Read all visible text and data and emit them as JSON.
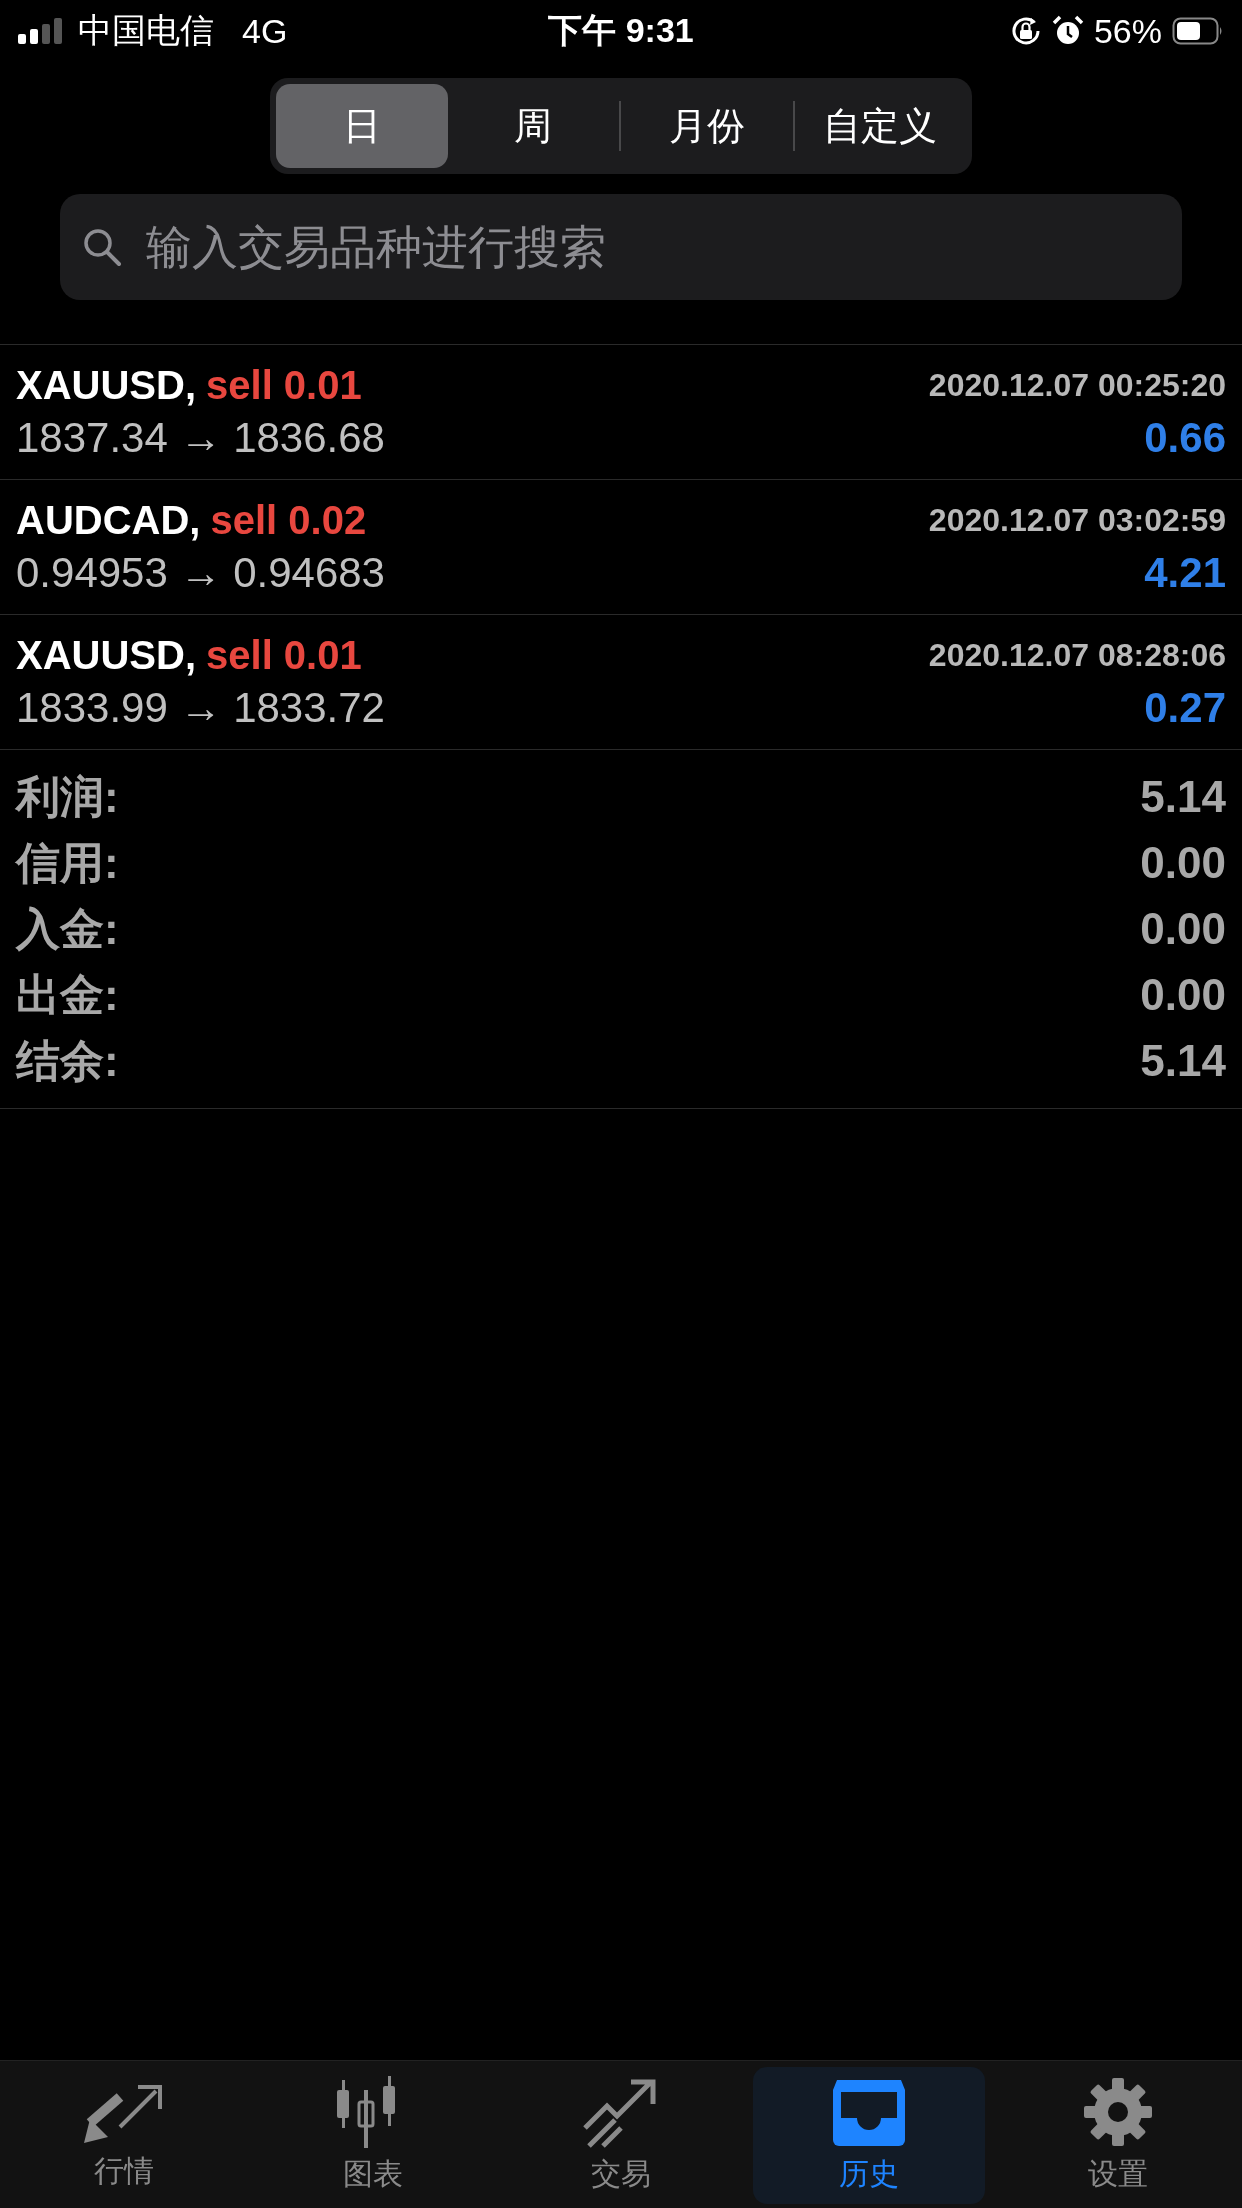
{
  "status_bar": {
    "carrier": "中国电信",
    "network": "4G",
    "time": "下午 9:31",
    "battery": "56%"
  },
  "period_tabs": [
    {
      "label": "日",
      "selected": true
    },
    {
      "label": "周",
      "selected": false
    },
    {
      "label": "月份",
      "selected": false
    },
    {
      "label": "自定义",
      "selected": false
    }
  ],
  "search": {
    "placeholder": "输入交易品种进行搜索"
  },
  "deals": [
    {
      "symbol": "XAUUSD,",
      "order": "sell 0.01",
      "time": "2020.12.07 00:25:20",
      "prices": "1837.34 → 1836.68",
      "profit": "0.66"
    },
    {
      "symbol": "AUDCAD,",
      "order": "sell 0.02",
      "time": "2020.12.07 03:02:59",
      "prices": "0.94953 → 0.94683",
      "profit": "4.21"
    },
    {
      "symbol": "XAUUSD,",
      "order": "sell 0.01",
      "time": "2020.12.07 08:28:06",
      "prices": "1833.99 → 1833.72",
      "profit": "0.27"
    }
  ],
  "summary": [
    {
      "label": "利润:",
      "value": "5.14"
    },
    {
      "label": "信用:",
      "value": "0.00"
    },
    {
      "label": "入金:",
      "value": "0.00"
    },
    {
      "label": "出金:",
      "value": "0.00"
    },
    {
      "label": "结余:",
      "value": "5.14"
    }
  ],
  "tab_bar": [
    {
      "label": "行情",
      "kind": "quotes",
      "selected": false
    },
    {
      "label": "图表",
      "kind": "chart",
      "selected": false
    },
    {
      "label": "交易",
      "kind": "trade",
      "selected": false
    },
    {
      "label": "历史",
      "kind": "history",
      "selected": true
    },
    {
      "label": "设置",
      "kind": "settings",
      "selected": false
    }
  ]
}
